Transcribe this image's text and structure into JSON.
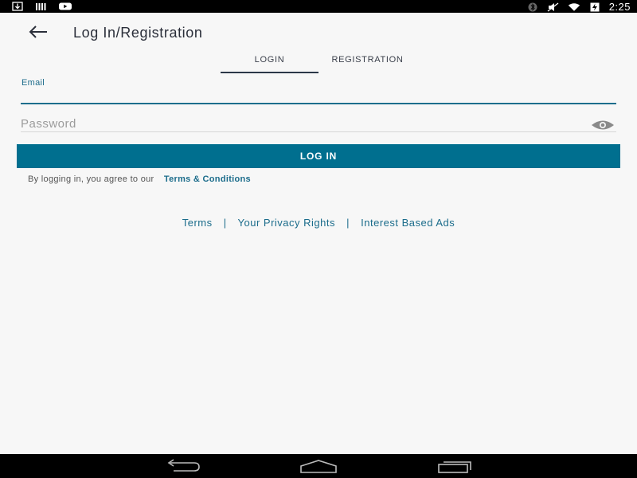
{
  "status_bar": {
    "time": "2:25",
    "left_icons": [
      "download-icon",
      "signal-bars-icon",
      "youtube-icon"
    ],
    "right_icons": [
      "bluetooth-icon",
      "mute-icon",
      "wifi-icon",
      "battery-charging-icon"
    ]
  },
  "app_bar": {
    "title": "Log In/Registration",
    "back_icon": "back-arrow-icon"
  },
  "tabs": [
    {
      "label": "LOGIN",
      "active": true
    },
    {
      "label": "REGISTRATION",
      "active": false
    }
  ],
  "form": {
    "email_label": "Email",
    "email_value": "",
    "password_placeholder": "Password",
    "password_value": "",
    "show_password_icon": "eye-icon",
    "login_button": "LOG IN",
    "agree_text": "By logging in, you agree to our",
    "terms_link": "Terms & Conditions"
  },
  "footer": {
    "links": [
      "Terms",
      "Your Privacy Rights",
      "Interest Based Ads"
    ],
    "separator": "|"
  },
  "nav_bar": {
    "buttons": [
      "back-nav-icon",
      "home-nav-icon",
      "recents-nav-icon"
    ]
  },
  "colors": {
    "accent": "#006f8f",
    "link": "#1b6c8b",
    "background": "#f7f7f7"
  }
}
